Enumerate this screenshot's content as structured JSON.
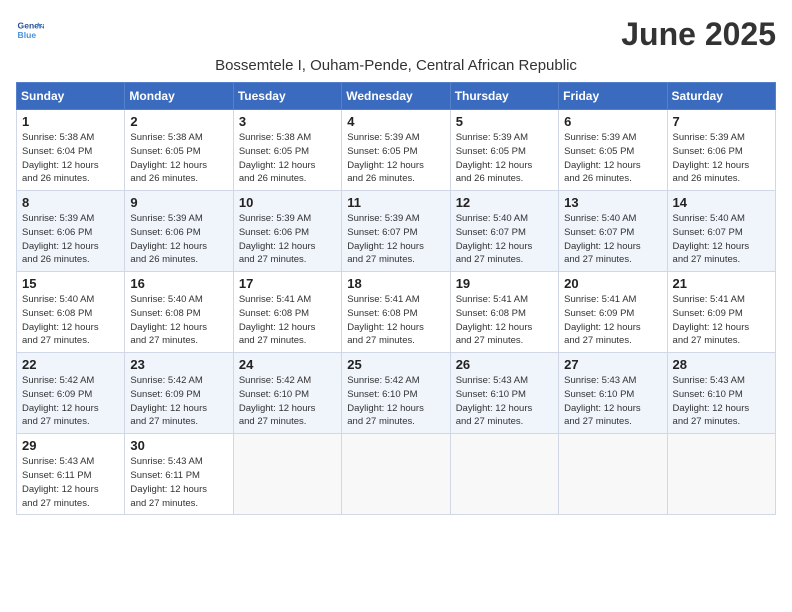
{
  "logo": {
    "line1": "General",
    "line2": "Blue"
  },
  "title": "June 2025",
  "subtitle": "Bossemtele I, Ouham-Pende, Central African Republic",
  "days_of_week": [
    "Sunday",
    "Monday",
    "Tuesday",
    "Wednesday",
    "Thursday",
    "Friday",
    "Saturday"
  ],
  "weeks": [
    [
      {
        "day": "1",
        "info": "Sunrise: 5:38 AM\nSunset: 6:04 PM\nDaylight: 12 hours\nand 26 minutes."
      },
      {
        "day": "2",
        "info": "Sunrise: 5:38 AM\nSunset: 6:05 PM\nDaylight: 12 hours\nand 26 minutes."
      },
      {
        "day": "3",
        "info": "Sunrise: 5:38 AM\nSunset: 6:05 PM\nDaylight: 12 hours\nand 26 minutes."
      },
      {
        "day": "4",
        "info": "Sunrise: 5:39 AM\nSunset: 6:05 PM\nDaylight: 12 hours\nand 26 minutes."
      },
      {
        "day": "5",
        "info": "Sunrise: 5:39 AM\nSunset: 6:05 PM\nDaylight: 12 hours\nand 26 minutes."
      },
      {
        "day": "6",
        "info": "Sunrise: 5:39 AM\nSunset: 6:05 PM\nDaylight: 12 hours\nand 26 minutes."
      },
      {
        "day": "7",
        "info": "Sunrise: 5:39 AM\nSunset: 6:06 PM\nDaylight: 12 hours\nand 26 minutes."
      }
    ],
    [
      {
        "day": "8",
        "info": "Sunrise: 5:39 AM\nSunset: 6:06 PM\nDaylight: 12 hours\nand 26 minutes."
      },
      {
        "day": "9",
        "info": "Sunrise: 5:39 AM\nSunset: 6:06 PM\nDaylight: 12 hours\nand 26 minutes."
      },
      {
        "day": "10",
        "info": "Sunrise: 5:39 AM\nSunset: 6:06 PM\nDaylight: 12 hours\nand 27 minutes."
      },
      {
        "day": "11",
        "info": "Sunrise: 5:39 AM\nSunset: 6:07 PM\nDaylight: 12 hours\nand 27 minutes."
      },
      {
        "day": "12",
        "info": "Sunrise: 5:40 AM\nSunset: 6:07 PM\nDaylight: 12 hours\nand 27 minutes."
      },
      {
        "day": "13",
        "info": "Sunrise: 5:40 AM\nSunset: 6:07 PM\nDaylight: 12 hours\nand 27 minutes."
      },
      {
        "day": "14",
        "info": "Sunrise: 5:40 AM\nSunset: 6:07 PM\nDaylight: 12 hours\nand 27 minutes."
      }
    ],
    [
      {
        "day": "15",
        "info": "Sunrise: 5:40 AM\nSunset: 6:08 PM\nDaylight: 12 hours\nand 27 minutes."
      },
      {
        "day": "16",
        "info": "Sunrise: 5:40 AM\nSunset: 6:08 PM\nDaylight: 12 hours\nand 27 minutes."
      },
      {
        "day": "17",
        "info": "Sunrise: 5:41 AM\nSunset: 6:08 PM\nDaylight: 12 hours\nand 27 minutes."
      },
      {
        "day": "18",
        "info": "Sunrise: 5:41 AM\nSunset: 6:08 PM\nDaylight: 12 hours\nand 27 minutes."
      },
      {
        "day": "19",
        "info": "Sunrise: 5:41 AM\nSunset: 6:08 PM\nDaylight: 12 hours\nand 27 minutes."
      },
      {
        "day": "20",
        "info": "Sunrise: 5:41 AM\nSunset: 6:09 PM\nDaylight: 12 hours\nand 27 minutes."
      },
      {
        "day": "21",
        "info": "Sunrise: 5:41 AM\nSunset: 6:09 PM\nDaylight: 12 hours\nand 27 minutes."
      }
    ],
    [
      {
        "day": "22",
        "info": "Sunrise: 5:42 AM\nSunset: 6:09 PM\nDaylight: 12 hours\nand 27 minutes."
      },
      {
        "day": "23",
        "info": "Sunrise: 5:42 AM\nSunset: 6:09 PM\nDaylight: 12 hours\nand 27 minutes."
      },
      {
        "day": "24",
        "info": "Sunrise: 5:42 AM\nSunset: 6:10 PM\nDaylight: 12 hours\nand 27 minutes."
      },
      {
        "day": "25",
        "info": "Sunrise: 5:42 AM\nSunset: 6:10 PM\nDaylight: 12 hours\nand 27 minutes."
      },
      {
        "day": "26",
        "info": "Sunrise: 5:43 AM\nSunset: 6:10 PM\nDaylight: 12 hours\nand 27 minutes."
      },
      {
        "day": "27",
        "info": "Sunrise: 5:43 AM\nSunset: 6:10 PM\nDaylight: 12 hours\nand 27 minutes."
      },
      {
        "day": "28",
        "info": "Sunrise: 5:43 AM\nSunset: 6:10 PM\nDaylight: 12 hours\nand 27 minutes."
      }
    ],
    [
      {
        "day": "29",
        "info": "Sunrise: 5:43 AM\nSunset: 6:11 PM\nDaylight: 12 hours\nand 27 minutes."
      },
      {
        "day": "30",
        "info": "Sunrise: 5:43 AM\nSunset: 6:11 PM\nDaylight: 12 hours\nand 27 minutes."
      },
      {
        "day": "",
        "info": ""
      },
      {
        "day": "",
        "info": ""
      },
      {
        "day": "",
        "info": ""
      },
      {
        "day": "",
        "info": ""
      },
      {
        "day": "",
        "info": ""
      }
    ]
  ]
}
